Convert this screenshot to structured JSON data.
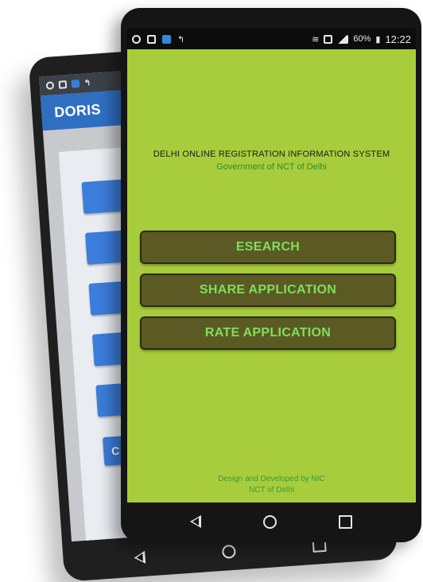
{
  "back_app": {
    "title": "DORIS",
    "partial_button_label": "C"
  },
  "status_bar": {
    "battery": "60%",
    "time": "12:22"
  },
  "header": {
    "system_name": "DELHI ONLINE REGISTRATION INFORMATION SYSTEM",
    "government": "Government of NCT of Delhi"
  },
  "actions": [
    {
      "label": "ESEARCH"
    },
    {
      "label": "SHARE APPLICATION"
    },
    {
      "label": "RATE APPLICATION"
    }
  ],
  "footer": {
    "line1": "Design and Developed by NIC",
    "line2": "NCT of Delhi"
  },
  "colors": {
    "screen_bg": "#a8cd3c",
    "button_bg": "#5c5a24",
    "button_text": "#7de05a",
    "back_appbar": "#2f6fc2",
    "back_button": "#3b7ddb"
  },
  "icons": [
    "status-icon",
    "gallery-icon",
    "app-icon",
    "network-icon",
    "wifi-icon",
    "sim-icon",
    "signal-icon",
    "battery-icon",
    "nav-back-icon",
    "nav-home-icon",
    "nav-recent-icon"
  ]
}
